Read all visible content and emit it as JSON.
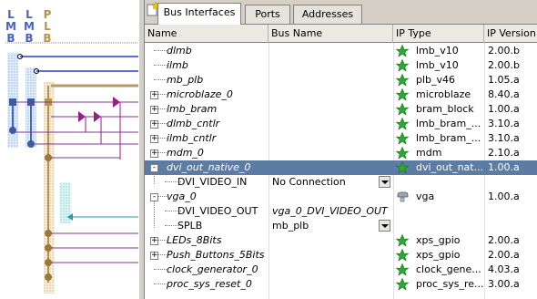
{
  "bus_panel": {
    "headers": [
      {
        "lines": [
          "L",
          "M",
          "B"
        ],
        "color": "#4a62c0"
      },
      {
        "lines": [
          "L",
          "M",
          "B"
        ],
        "color": "#4a62c0"
      },
      {
        "lines": [
          "P",
          "L",
          "B"
        ],
        "color": "#b8914a"
      }
    ]
  },
  "tabs": [
    {
      "label": "Bus Interfaces",
      "active": true
    },
    {
      "label": "Ports",
      "active": false
    },
    {
      "label": "Addresses",
      "active": false
    }
  ],
  "columns": {
    "name": "Name",
    "bus_name": "Bus Name",
    "ip_type": "IP Type",
    "ip_version": "IP Version"
  },
  "rows": [
    {
      "name": "dlmb",
      "bus": "",
      "type": "lmb_v10",
      "version": "2.00.b",
      "italic": true,
      "indent": 0,
      "expander": "",
      "icon": "star-icon"
    },
    {
      "name": "ilmb",
      "bus": "",
      "type": "lmb_v10",
      "version": "2.00.b",
      "italic": true,
      "indent": 0,
      "expander": "",
      "icon": "star-icon"
    },
    {
      "name": "mb_plb",
      "bus": "",
      "type": "plb_v46",
      "version": "1.05.a",
      "italic": true,
      "indent": 0,
      "expander": "",
      "icon": "star-icon"
    },
    {
      "name": "microblaze_0",
      "bus": "",
      "type": "microblaze",
      "version": "8.40.a",
      "italic": true,
      "indent": 0,
      "expander": "+",
      "icon": "star-icon"
    },
    {
      "name": "lmb_bram",
      "bus": "",
      "type": "bram_block",
      "version": "1.00.a",
      "italic": true,
      "indent": 0,
      "expander": "+",
      "icon": "star-icon"
    },
    {
      "name": "dlmb_cntlr",
      "bus": "",
      "type": "lmb_bram_...",
      "version": "3.10.a",
      "italic": true,
      "indent": 0,
      "expander": "+",
      "icon": "star-icon"
    },
    {
      "name": "ilmb_cntlr",
      "bus": "",
      "type": "lmb_bram_...",
      "version": "3.10.a",
      "italic": true,
      "indent": 0,
      "expander": "+",
      "icon": "star-icon"
    },
    {
      "name": "mdm_0",
      "bus": "",
      "type": "mdm",
      "version": "2.10.a",
      "italic": true,
      "indent": 0,
      "expander": "+",
      "icon": "star-icon"
    },
    {
      "name": "dvi_out_native_0",
      "bus": "",
      "type": "dvi_out_nat...",
      "version": "1.00.a",
      "italic": true,
      "indent": 0,
      "expander": "-",
      "icon": "star-icon",
      "selected": true
    },
    {
      "name": "DVI_VIDEO_IN",
      "bus": "No Connection",
      "type": "",
      "version": "",
      "italic": false,
      "indent": 1,
      "expander": "",
      "icon": "",
      "dropdown": true
    },
    {
      "name": "vga_0",
      "bus": "",
      "type": "vga",
      "version": "1.00.a",
      "italic": true,
      "indent": 0,
      "expander": "-",
      "icon": "plug-icon"
    },
    {
      "name": "DVI_VIDEO_OUT",
      "bus": "vga_0_DVI_VIDEO_OUT",
      "type": "",
      "version": "",
      "italic": false,
      "indent": 1,
      "expander": "",
      "icon": "",
      "bus_italic": true
    },
    {
      "name": "SPLB",
      "bus": "mb_plb",
      "type": "",
      "version": "",
      "italic": false,
      "indent": 1,
      "expander": "",
      "icon": "",
      "dropdown": true
    },
    {
      "name": "LEDs_8Bits",
      "bus": "",
      "type": "xps_gpio",
      "version": "2.00.a",
      "italic": true,
      "indent": 0,
      "expander": "+",
      "icon": "star-icon"
    },
    {
      "name": "Push_Buttons_5Bits",
      "bus": "",
      "type": "xps_gpio",
      "version": "2.00.a",
      "italic": true,
      "indent": 0,
      "expander": "+",
      "icon": "star-icon"
    },
    {
      "name": "clock_generator_0",
      "bus": "",
      "type": "clock_gene...",
      "version": "4.03.a",
      "italic": true,
      "indent": 0,
      "expander": "",
      "icon": "star-icon"
    },
    {
      "name": "proc_sys_reset_0",
      "bus": "",
      "type": "proc_sys_re...",
      "version": "3.00.a",
      "italic": true,
      "indent": 0,
      "expander": "",
      "icon": "star-icon"
    }
  ],
  "colors": {
    "selected_row": "#5d7ca3",
    "lmb_bus": "#4a62c0",
    "plb_bus": "#b8914a",
    "star_green": "#2fa82f"
  }
}
